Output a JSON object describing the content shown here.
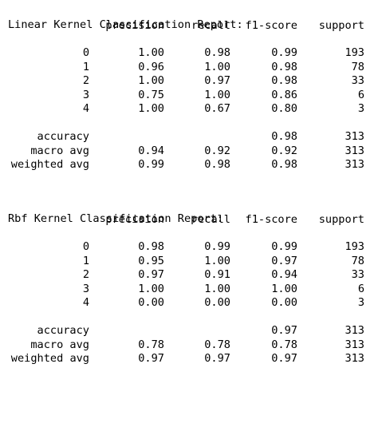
{
  "reports": [
    {
      "title": "Linear Kernel Classification Report:",
      "headers": {
        "precision": "precision",
        "recall": "recall",
        "f1": "f1-score",
        "support": "support"
      },
      "classes": [
        {
          "label": "0",
          "precision": "1.00",
          "recall": "0.98",
          "f1": "0.99",
          "support": "193"
        },
        {
          "label": "1",
          "precision": "0.96",
          "recall": "1.00",
          "f1": "0.98",
          "support": "78"
        },
        {
          "label": "2",
          "precision": "1.00",
          "recall": "0.97",
          "f1": "0.98",
          "support": "33"
        },
        {
          "label": "3",
          "precision": "0.75",
          "recall": "1.00",
          "f1": "0.86",
          "support": "6"
        },
        {
          "label": "4",
          "precision": "1.00",
          "recall": "0.67",
          "f1": "0.80",
          "support": "3"
        }
      ],
      "summary": [
        {
          "label": "accuracy",
          "precision": "",
          "recall": "",
          "f1": "0.98",
          "support": "313"
        },
        {
          "label": "macro avg",
          "precision": "0.94",
          "recall": "0.92",
          "f1": "0.92",
          "support": "313"
        },
        {
          "label": "weighted avg",
          "precision": "0.99",
          "recall": "0.98",
          "f1": "0.98",
          "support": "313"
        }
      ]
    },
    {
      "title": "Rbf Kernel Classification Report:",
      "headers": {
        "precision": "precision",
        "recall": "recall",
        "f1": "f1-score",
        "support": "support"
      },
      "classes": [
        {
          "label": "0",
          "precision": "0.98",
          "recall": "0.99",
          "f1": "0.99",
          "support": "193"
        },
        {
          "label": "1",
          "precision": "0.95",
          "recall": "1.00",
          "f1": "0.97",
          "support": "78"
        },
        {
          "label": "2",
          "precision": "0.97",
          "recall": "0.91",
          "f1": "0.94",
          "support": "33"
        },
        {
          "label": "3",
          "precision": "1.00",
          "recall": "1.00",
          "f1": "1.00",
          "support": "6"
        },
        {
          "label": "4",
          "precision": "0.00",
          "recall": "0.00",
          "f1": "0.00",
          "support": "3"
        }
      ],
      "summary": [
        {
          "label": "accuracy",
          "precision": "",
          "recall": "",
          "f1": "0.97",
          "support": "313"
        },
        {
          "label": "macro avg",
          "precision": "0.78",
          "recall": "0.78",
          "f1": "0.78",
          "support": "313"
        },
        {
          "label": "weighted avg",
          "precision": "0.97",
          "recall": "0.97",
          "f1": "0.97",
          "support": "313"
        }
      ]
    }
  ]
}
